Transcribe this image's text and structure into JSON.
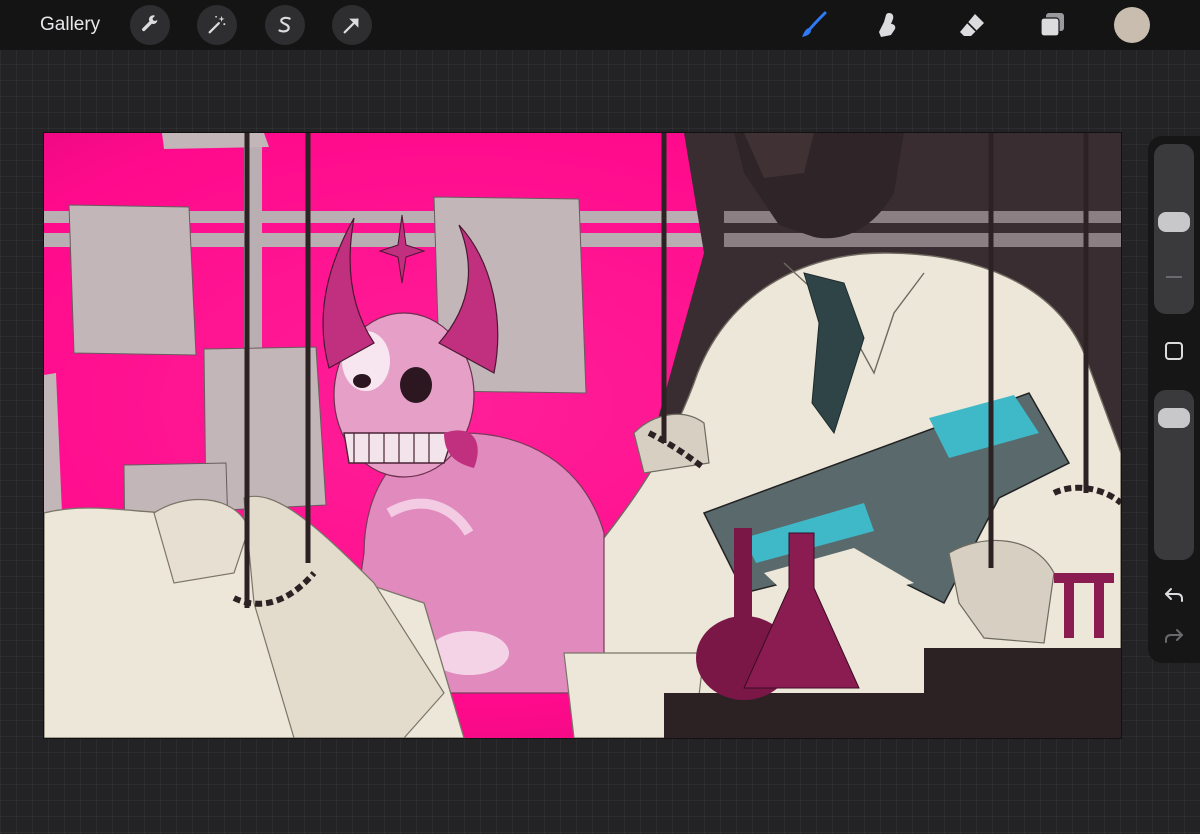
{
  "toolbar": {
    "gallery_label": "Gallery",
    "left_tools": [
      {
        "name": "actions",
        "icon": "wrench-icon"
      },
      {
        "name": "adjustments",
        "icon": "magic-wand-icon"
      },
      {
        "name": "selection",
        "icon": "selection-s-icon"
      },
      {
        "name": "transform",
        "icon": "transform-arrow-icon"
      }
    ],
    "right_tools": [
      {
        "name": "brush",
        "icon": "brush-icon",
        "active": true
      },
      {
        "name": "smudge",
        "icon": "smudge-finger-icon",
        "active": false
      },
      {
        "name": "eraser",
        "icon": "eraser-icon",
        "active": false
      },
      {
        "name": "layers",
        "icon": "layers-icon",
        "active": false
      }
    ],
    "current_color": "#c9bdb0",
    "active_color": "#2f7bf6",
    "bar_color": "#141415"
  },
  "sidebar": {
    "brush_size": 0.55,
    "brush_opacity": 0.9,
    "modify_button_icon": "square-icon",
    "undo_icon": "undo-icon",
    "redo_icon": "redo-icon"
  },
  "artwork": {
    "palette": {
      "magenta": "#ff0a8c",
      "paper": "#ede7da",
      "skin": "#e08abd",
      "dark": "#2c2224",
      "teal": "#3fb8c8",
      "tie": "#2f4446",
      "flask": "#7a1746"
    }
  }
}
